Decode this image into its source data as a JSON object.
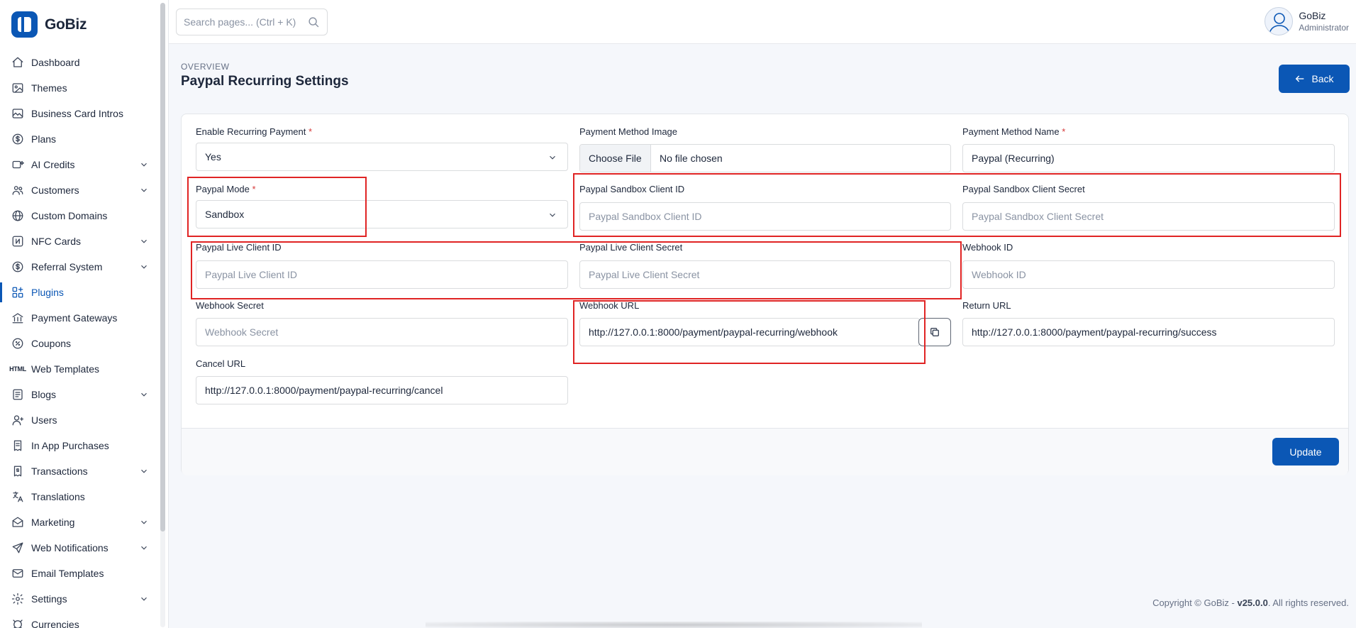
{
  "brand": {
    "name": "GoBiz"
  },
  "header": {
    "search_placeholder": "Search pages... (Ctrl + K)",
    "user_name": "GoBiz",
    "user_role": "Administrator"
  },
  "sidebar": {
    "items": [
      {
        "label": "Dashboard",
        "icon": "home-icon",
        "has_children": false
      },
      {
        "label": "Themes",
        "icon": "image-icon",
        "has_children": false
      },
      {
        "label": "Business Card Intros",
        "icon": "photo-icon",
        "has_children": false
      },
      {
        "label": "Plans",
        "icon": "dollar-circle-icon",
        "has_children": false
      },
      {
        "label": "AI Credits",
        "icon": "ai-icon",
        "has_children": true
      },
      {
        "label": "Customers",
        "icon": "users-icon",
        "has_children": true
      },
      {
        "label": "Custom Domains",
        "icon": "globe-icon",
        "has_children": false
      },
      {
        "label": "NFC Cards",
        "icon": "nfc-icon",
        "has_children": true
      },
      {
        "label": "Referral System",
        "icon": "dollar-circle-icon",
        "has_children": true
      },
      {
        "label": "Plugins",
        "icon": "apps-icon",
        "has_children": false,
        "active": true
      },
      {
        "label": "Payment Gateways",
        "icon": "building-bank-icon",
        "has_children": false
      },
      {
        "label": "Coupons",
        "icon": "discount-icon",
        "has_children": false
      },
      {
        "label": "Web Templates",
        "icon": "html-icon",
        "has_children": false
      },
      {
        "label": "Blogs",
        "icon": "list-icon",
        "has_children": true
      },
      {
        "label": "Users",
        "icon": "user-icon",
        "has_children": false
      },
      {
        "label": "In App Purchases",
        "icon": "receipt-icon",
        "has_children": false
      },
      {
        "label": "Transactions",
        "icon": "receipt-dollar-icon",
        "has_children": true
      },
      {
        "label": "Translations",
        "icon": "language-icon",
        "has_children": false
      },
      {
        "label": "Marketing",
        "icon": "mail-open-icon",
        "has_children": true
      },
      {
        "label": "Web Notifications",
        "icon": "send-icon",
        "has_children": true
      },
      {
        "label": "Email Templates",
        "icon": "mail-icon",
        "has_children": false
      },
      {
        "label": "Settings",
        "icon": "gear-icon",
        "has_children": true
      },
      {
        "label": "Currencies",
        "icon": "currency-icon",
        "has_children": false
      }
    ]
  },
  "page": {
    "pretitle": "Overview",
    "title": "Paypal Recurring Settings",
    "back_label": "Back"
  },
  "form": {
    "enable_recurring": {
      "label": "Enable Recurring Payment",
      "required": "*",
      "value": "Yes"
    },
    "method_image": {
      "label": "Payment Method Image",
      "button": "Choose File",
      "status": "No file chosen"
    },
    "method_name": {
      "label": "Payment Method Name",
      "required": "*",
      "value": "Paypal (Recurring)"
    },
    "paypal_mode": {
      "label": "Paypal Mode",
      "required": "*",
      "value": "Sandbox"
    },
    "sandbox_client_id": {
      "label": "Paypal Sandbox Client ID",
      "placeholder": "Paypal Sandbox Client ID"
    },
    "sandbox_client_secret": {
      "label": "Paypal Sandbox Client Secret",
      "placeholder": "Paypal Sandbox Client Secret"
    },
    "live_client_id": {
      "label": "Paypal Live Client ID",
      "placeholder": "Paypal Live Client ID"
    },
    "live_client_secret": {
      "label": "Paypal Live Client Secret",
      "placeholder": "Paypal Live Client Secret"
    },
    "webhook_id": {
      "label": "Webhook ID",
      "placeholder": "Webhook ID"
    },
    "webhook_secret": {
      "label": "Webhook Secret",
      "placeholder": "Webhook Secret"
    },
    "webhook_url": {
      "label": "Webhook URL",
      "value": "http://127.0.0.1:8000/payment/paypal-recurring/webhook"
    },
    "return_url": {
      "label": "Return URL",
      "value": "http://127.0.0.1:8000/payment/paypal-recurring/success"
    },
    "cancel_url": {
      "label": "Cancel URL",
      "value": "http://127.0.0.1:8000/payment/paypal-recurring/cancel"
    },
    "update_label": "Update"
  },
  "footer": {
    "copyright_prefix": "Copyright © GoBiz - ",
    "version": "v25.0.0",
    "copyright_suffix": ". All rights reserved."
  },
  "colors": {
    "primary": "#0b57b5",
    "highlight": "#e02424",
    "required": "#d63939"
  }
}
